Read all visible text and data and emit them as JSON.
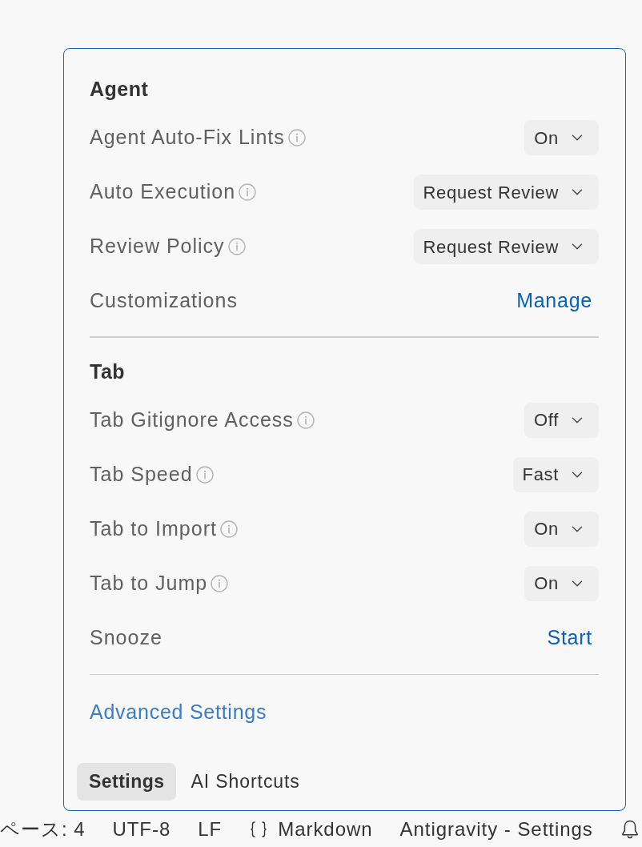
{
  "panel": {
    "sections": [
      {
        "heading": "Agent",
        "rows": [
          {
            "kind": "dropdown",
            "label": "Agent Auto-Fix Lints",
            "info": true,
            "value": "On"
          },
          {
            "kind": "dropdown",
            "label": "Auto Execution",
            "info": true,
            "value": "Request Review"
          },
          {
            "kind": "dropdown",
            "label": "Review Policy",
            "info": true,
            "value": "Request Review"
          },
          {
            "kind": "link",
            "label": "Customizations",
            "info": false,
            "value": "Manage"
          }
        ]
      },
      {
        "heading": "Tab",
        "rows": [
          {
            "kind": "dropdown",
            "label": "Tab Gitignore Access",
            "info": true,
            "value": "Off"
          },
          {
            "kind": "dropdown",
            "label": "Tab Speed",
            "info": true,
            "value": "Fast"
          },
          {
            "kind": "dropdown",
            "label": "Tab to Import",
            "info": true,
            "value": "On"
          },
          {
            "kind": "dropdown",
            "label": "Tab to Jump",
            "info": true,
            "value": "On"
          },
          {
            "kind": "link",
            "label": "Snooze",
            "info": false,
            "value": "Start"
          }
        ]
      }
    ],
    "advanced_link": "Advanced Settings",
    "tabs": [
      {
        "label": "Settings",
        "selected": true
      },
      {
        "label": "AI Shortcuts",
        "selected": false
      }
    ]
  },
  "status_bar": {
    "items": [
      {
        "kind": "text",
        "text": "ペース: 4"
      },
      {
        "kind": "text",
        "text": "UTF-8"
      },
      {
        "kind": "text",
        "text": "LF"
      },
      {
        "kind": "language",
        "text": "Markdown"
      },
      {
        "kind": "text",
        "text": "Antigravity - Settings"
      },
      {
        "kind": "bell"
      }
    ]
  }
}
